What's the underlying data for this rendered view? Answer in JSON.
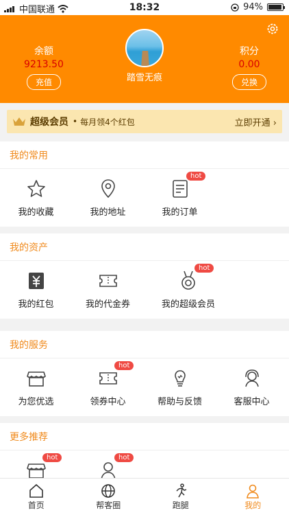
{
  "status_bar": {
    "carrier": "中国联通",
    "time": "18:32",
    "battery": "94%"
  },
  "header": {
    "balance_label": "余额",
    "balance_value": "9213.50",
    "recharge_label": "充值",
    "username": "踏雪无痕",
    "points_label": "积分",
    "points_value": "0.00",
    "redeem_label": "兑换"
  },
  "vip_banner": {
    "title": "超级会员",
    "subtitle": "每月领4个红包",
    "cta": "立即开通"
  },
  "sections": {
    "common": {
      "title": "我的常用",
      "items": [
        "我的收藏",
        "我的地址",
        "我的订单"
      ]
    },
    "assets": {
      "title": "我的资产",
      "items": [
        "我的红包",
        "我的代金券",
        "我的超级会员"
      ]
    },
    "services": {
      "title": "我的服务",
      "items": [
        "为您优选",
        "领券中心",
        "帮助与反馈",
        "客服中心"
      ]
    },
    "more": {
      "title": "更多推荐"
    }
  },
  "hot_badge": "hot",
  "tabs": [
    "首页",
    "帮客圈",
    "跑腿",
    "我的"
  ],
  "colors": {
    "accent": "#ff8a00",
    "section_title": "#f08a1c",
    "badge": "#ef4a43",
    "vip_bg": "#fbe6b0"
  }
}
